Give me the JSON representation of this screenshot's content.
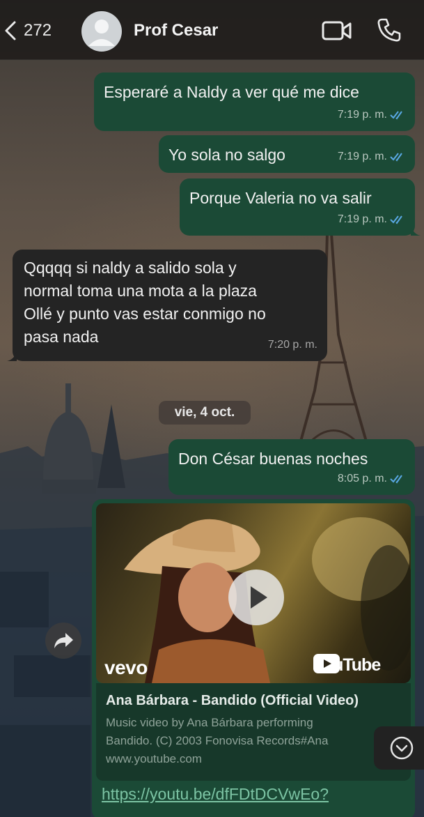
{
  "header": {
    "back_count": "272",
    "contact_name": "Prof Cesar",
    "icons": [
      "chevron-left-icon",
      "avatar-icon",
      "video-camera-icon",
      "phone-icon"
    ]
  },
  "messages": [
    {
      "direction": "out",
      "text": "Esperaré a Naldy a ver qué me dice",
      "time": "7:19 p. m.",
      "status": "read"
    },
    {
      "direction": "out",
      "text": "Yo sola no salgo",
      "time": "7:19 p. m.",
      "status": "read"
    },
    {
      "direction": "out",
      "text": "Porque Valeria no va salir",
      "time": "7:19 p. m.",
      "status": "read"
    },
    {
      "direction": "in",
      "lines": [
        "Qqqqq si naldy a salido sola y",
        "normal toma una mota a la plaza",
        "Ollé y punto vas estar conmigo no",
        "pasa nada"
      ],
      "time": "7:20 p. m."
    }
  ],
  "date_separator": "vie, 4 oct.",
  "later_messages": [
    {
      "direction": "out",
      "text": "Don César buenas noches",
      "time": "8:05 p. m.",
      "status": "read"
    }
  ],
  "link_preview": {
    "brand": "vevo",
    "platform": "YouTube",
    "title": "Ana Bárbara - Bandido (Official Video)",
    "desc_line1": "Music video by Ana Bárbara performing",
    "desc_line2": "Bandido. (C) 2003 Fonovisa Records#Ana",
    "domain": "www.youtube.com",
    "url": "https://youtu.be/dfFDtDCVwEo?"
  },
  "colors": {
    "outgoing_bubble": "#1b4a36",
    "incoming_bubble": "#242424",
    "read_ticks": "#5aa9e6",
    "link": "#7cc4a4"
  }
}
